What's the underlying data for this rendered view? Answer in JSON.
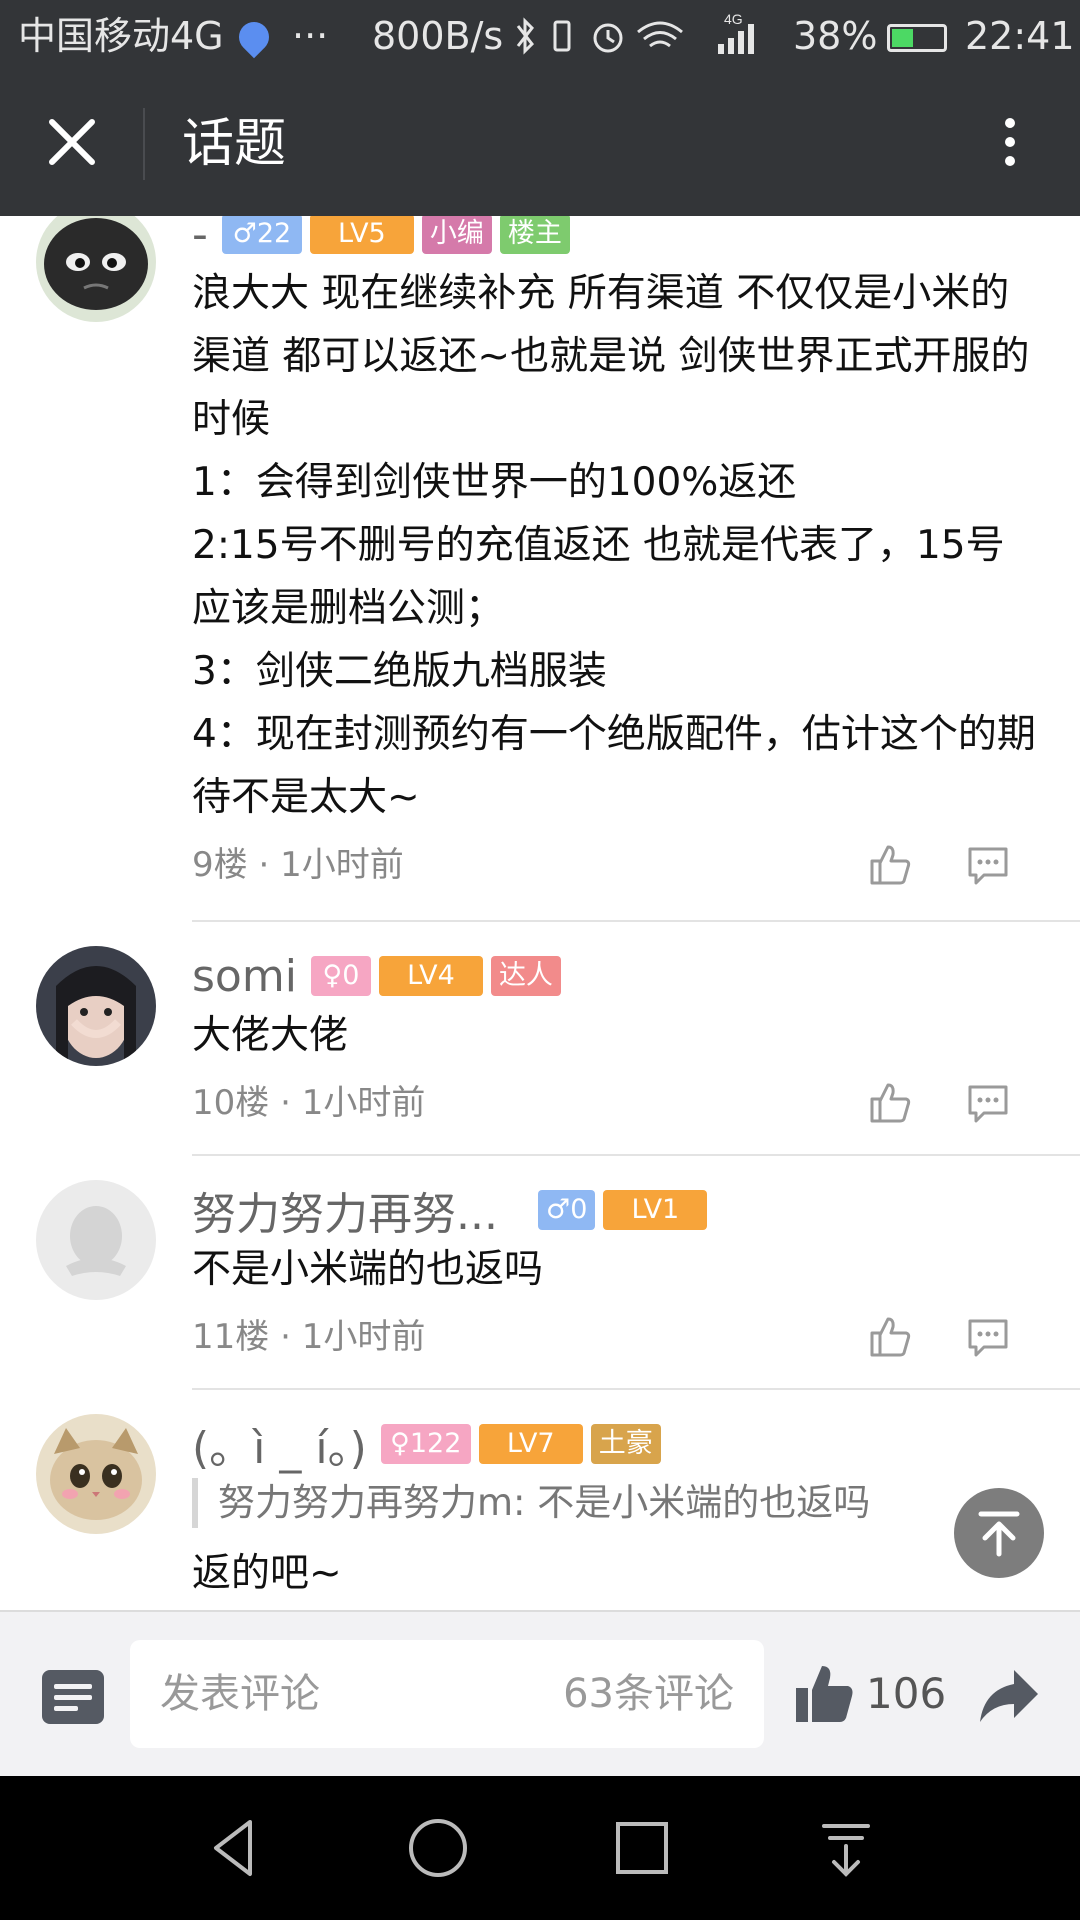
{
  "status_bar": {
    "carrier": "中国移动4G",
    "dots": "···",
    "speed": "800B/s",
    "network": "4G",
    "battery": "38%",
    "time": "22:41"
  },
  "nav": {
    "title": "话题"
  },
  "comments": [
    {
      "name": "-",
      "gender": "♂",
      "gender_value": "22",
      "level": "LV5",
      "badges": [
        "小编",
        "楼主"
      ],
      "text": "浪大大 现在继续补充 所有渠道 不仅仅是小米的渠道 都可以返还~也就是说 剑侠世界正式开服的时候\n1：会得到剑侠世界一的100%返还\n2:15号不删号的充值返还 也就是代表了，15号应该是删档公测；\n3：剑侠二绝版九档服装\n4：现在封测预约有一个绝版配件，估计这个的期待不是太大~",
      "floor": "9楼",
      "time": "1小时前"
    },
    {
      "name": "somi",
      "gender": "♀",
      "gender_value": "0",
      "level": "LV4",
      "badges": [
        "达人"
      ],
      "text": "大佬大佬",
      "floor": "10楼",
      "time": "1小时前"
    },
    {
      "name": "努力努力再努...",
      "gender": "♂",
      "gender_value": "0",
      "level": "LV1",
      "badges": [],
      "text": "不是小米端的也返吗",
      "floor": "11楼",
      "time": "1小时前"
    },
    {
      "name": "(。ì _ í。)",
      "gender": "♀",
      "gender_value": "122",
      "level": "LV7",
      "badges": [
        "土豪"
      ],
      "quote": "努力努力再努力m: 不是小米端的也返吗",
      "text": "返的吧~"
    }
  ],
  "meta_sep": "·",
  "bottom_bar": {
    "placeholder": "发表评论",
    "comment_count": "63条评论",
    "like_count": "106"
  }
}
